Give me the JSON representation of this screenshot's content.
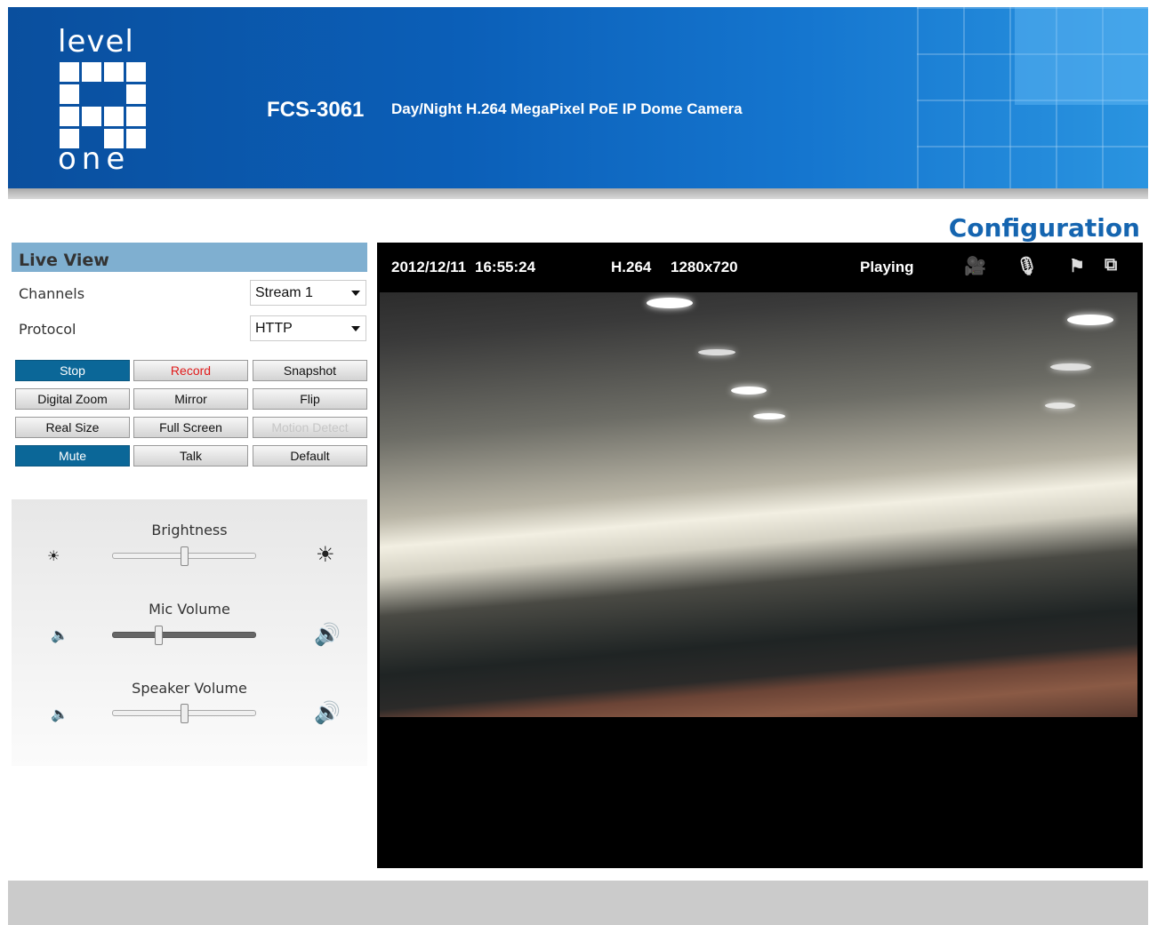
{
  "header": {
    "logo_top": "level",
    "logo_bottom": "one",
    "model": "FCS-3061",
    "description": "Day/Night H.264 MegaPixel PoE IP Dome Camera"
  },
  "nav": {
    "configuration": "Configuration"
  },
  "live_view": {
    "title": "Live View",
    "channels_label": "Channels",
    "channels_value": "Stream 1",
    "protocol_label": "Protocol",
    "protocol_value": "HTTP",
    "buttons": {
      "stop": "Stop",
      "record": "Record",
      "snapshot": "Snapshot",
      "digital_zoom": "Digital Zoom",
      "mirror": "Mirror",
      "flip": "Flip",
      "real_size": "Real Size",
      "full_screen": "Full Screen",
      "motion_detect": "Motion Detect",
      "mute": "Mute",
      "talk": "Talk",
      "default": "Default"
    }
  },
  "sliders": {
    "brightness": {
      "label": "Brightness",
      "level": 0.5
    },
    "mic_volume": {
      "label": "Mic Volume",
      "level": 0.32
    },
    "speaker_volume": {
      "label": "Speaker Volume",
      "level": 0.5
    }
  },
  "video": {
    "date": "2012/12/11",
    "time": "16:55:24",
    "codec": "H.264",
    "resolution": "1280x720",
    "status": "Playing",
    "icons": [
      "camera-record-icon",
      "microphone-icon",
      "flag-icon",
      "window-icon"
    ]
  },
  "colors": {
    "header_blue": "#0b5fb8",
    "active_button": "#0b6798",
    "record_red": "#e01b1b",
    "config_blue": "#1565b0",
    "panel_head": "#7fafd0"
  }
}
